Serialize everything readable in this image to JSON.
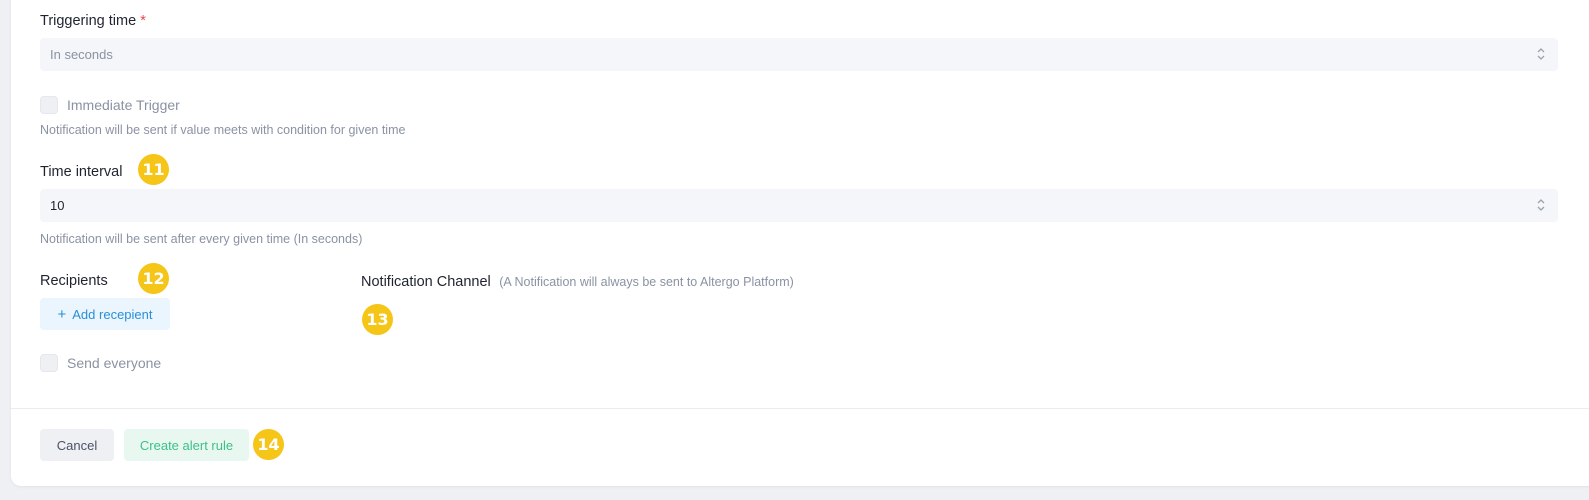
{
  "triggering_time": {
    "label": "Triggering time",
    "required_mark": "*",
    "placeholder": "In seconds"
  },
  "immediate_trigger": {
    "label": "Immediate Trigger",
    "checked": false,
    "help": "Notification will be sent if value meets with condition for given time"
  },
  "time_interval": {
    "label": "Time interval",
    "badge": "11",
    "value": "10",
    "help": "Notification will be sent after every given time (In seconds)"
  },
  "recipients": {
    "label": "Recipients",
    "badge": "12",
    "add_button": "Add recepient",
    "add_icon": "+",
    "send_everyone": "Send everyone",
    "send_everyone_checked": false
  },
  "notification_channel": {
    "label": "Notification Channel",
    "note": "(A Notification will always be sent to Altergo Platform)",
    "badge": "13"
  },
  "footer": {
    "cancel": "Cancel",
    "create": "Create alert rule",
    "badge": "14"
  },
  "colors": {
    "badge": "#f5c518",
    "required": "#e5484d",
    "add_button_text": "#2b8fd8",
    "create_button_text": "#3cc08a"
  }
}
